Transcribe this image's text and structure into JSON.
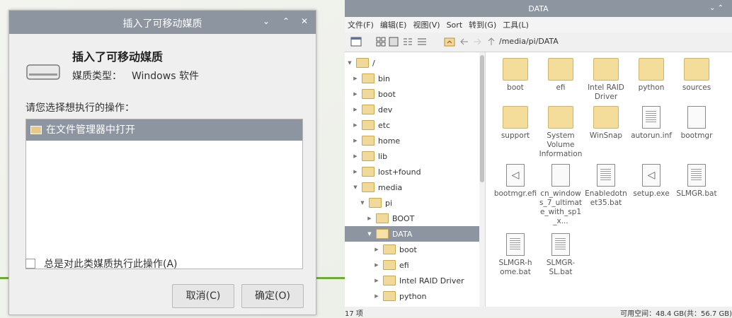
{
  "dialog": {
    "title": "插入了可移动媒质",
    "title_controls": [
      "⌄",
      "⌃",
      "✕"
    ],
    "heading": "插入了可移动媒质",
    "media_type_label": "媒质类型：",
    "media_type_value": "Windows 软件",
    "prompt": "请您选择想执行的操作：",
    "actions": [
      "在文件管理器中打开"
    ],
    "always_checkbox_label": "总是对此类媒质执行此操作(A)",
    "cancel_label": "取消(C)",
    "ok_label": "确定(O)"
  },
  "filemanager": {
    "title": "DATA",
    "title_controls": [
      "⌄",
      "⌃"
    ],
    "menu": [
      "文件(F)",
      "编辑(E)",
      "视图(V)",
      "Sort",
      "转到(G)",
      "工具(L)"
    ],
    "path": "/media/pi/DATA",
    "tree": [
      {
        "label": "/",
        "level": 0,
        "expanded": true
      },
      {
        "label": "bin",
        "level": 1
      },
      {
        "label": "boot",
        "level": 1
      },
      {
        "label": "dev",
        "level": 1
      },
      {
        "label": "etc",
        "level": 1
      },
      {
        "label": "home",
        "level": 1
      },
      {
        "label": "lib",
        "level": 1
      },
      {
        "label": "lost+found",
        "level": 1
      },
      {
        "label": "media",
        "level": 1,
        "expanded": true
      },
      {
        "label": "pi",
        "level": 2,
        "expanded": true
      },
      {
        "label": "BOOT",
        "level": 3
      },
      {
        "label": "DATA",
        "level": 3,
        "expanded": true,
        "selected": true
      },
      {
        "label": "boot",
        "level": 4
      },
      {
        "label": "efi",
        "level": 4
      },
      {
        "label": "Intel RAID Driver",
        "level": 4
      },
      {
        "label": "python",
        "level": 4
      }
    ],
    "items": [
      {
        "name": "boot",
        "kind": "folder"
      },
      {
        "name": "efi",
        "kind": "folder"
      },
      {
        "name": "Intel RAID Driver",
        "kind": "folder"
      },
      {
        "name": "python",
        "kind": "folder"
      },
      {
        "name": "sources",
        "kind": "folder"
      },
      {
        "name": "support",
        "kind": "folder"
      },
      {
        "name": "System Volume Information",
        "kind": "folder"
      },
      {
        "name": "WinSnap",
        "kind": "folder"
      },
      {
        "name": "autorun.inf",
        "kind": "doc"
      },
      {
        "name": "bootmgr",
        "kind": "blank"
      },
      {
        "name": "bootmgr.efi",
        "kind": "exe"
      },
      {
        "name": "cn_windows_7_ultimate_with_sp1_x...",
        "kind": "blank"
      },
      {
        "name": "Enabledotnet35.bat",
        "kind": "doc"
      },
      {
        "name": "setup.exe",
        "kind": "exe"
      },
      {
        "name": "SLMGR.bat",
        "kind": "doc"
      },
      {
        "name": "SLMGR-home.bat",
        "kind": "doc"
      },
      {
        "name": "SLMGR-SL.bat",
        "kind": "doc"
      }
    ],
    "status_left": "17 项",
    "status_right": "可用空间：48.4 GB(共：56.7 GB)"
  }
}
